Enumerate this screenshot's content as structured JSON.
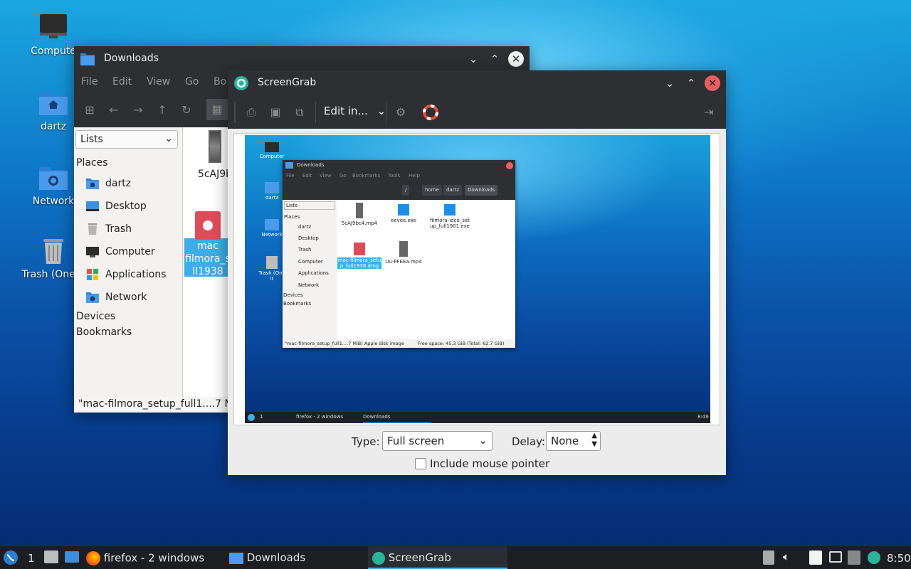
{
  "desktop": {
    "icons": [
      {
        "label": "Compute",
        "icon": "computer-icon"
      },
      {
        "label": "dartz",
        "icon": "home-folder-icon"
      },
      {
        "label": "Network",
        "icon": "network-folder-icon"
      },
      {
        "label": "Trash (One it",
        "icon": "trash-icon"
      }
    ]
  },
  "file_manager": {
    "title": "Downloads",
    "menu": [
      "File",
      "Edit",
      "View",
      "Go",
      "Bo"
    ],
    "view_mode": "Lists",
    "places_header": "Places",
    "places": [
      {
        "label": "dartz",
        "icon": "home-folder-icon"
      },
      {
        "label": "Desktop",
        "icon": "desktop-icon"
      },
      {
        "label": "Trash",
        "icon": "trash-icon"
      },
      {
        "label": "Computer",
        "icon": "computer-icon"
      },
      {
        "label": "Applications",
        "icon": "applications-icon"
      },
      {
        "label": "Network",
        "icon": "network-folder-icon"
      }
    ],
    "devices_header": "Devices",
    "bookmarks_header": "Bookmarks",
    "files": [
      {
        "label": "5cAJ9b",
        "icon": "video-file-icon"
      },
      {
        "label_lines": [
          "mac",
          "filmora_s",
          "ll1938"
        ],
        "icon": "dmg-file-icon",
        "selected": true
      }
    ],
    "status": "\"mac-filmora_setup_full1....7 M"
  },
  "screengrab": {
    "title": "ScreenGrab",
    "edit_label": "Edit in...",
    "type_label": "Type:",
    "type_value": "Full screen",
    "delay_label": "Delay:",
    "delay_value": "None",
    "include_pointer_label": "Include mouse pointer",
    "include_pointer_checked": false,
    "preview": {
      "desktop_icons": [
        "Computer",
        "dartz",
        "Network",
        "Trash (One it"
      ],
      "window_title": "Downloads",
      "menu": [
        "File",
        "Edit",
        "View",
        "Go",
        "Bookmarks",
        "Tools",
        "Help"
      ],
      "breadcrumbs": [
        "/",
        "home",
        "dartz",
        "Downloads"
      ],
      "view_mode": "Lists",
      "places_header": "Places",
      "places": [
        "dartz",
        "Desktop",
        "Trash",
        "Computer",
        "Applications",
        "Network"
      ],
      "devices_header": "Devices",
      "bookmarks_header": "Bookmarks",
      "files": [
        {
          "label": "5cAJ9bc4.mp4"
        },
        {
          "label": "eevee.exe"
        },
        {
          "label": "filmora-idco_setup_full1901.exe"
        },
        {
          "label": "mac-filmora_setup_full1938.dmg",
          "selected": true
        },
        {
          "label": "Uu-PFEEa.mp4"
        }
      ],
      "status_left": "\"mac-filmora_setup_full1....7 MiB) Apple disk image",
      "status_right": "Free space: 45.3 GiB (Total: 62.7 GiB)",
      "taskbar": {
        "workspace": "1",
        "firefox": "firefox - 2 windows",
        "downloads": "Downloads",
        "clock": "8:49"
      }
    }
  },
  "taskbar": {
    "workspace": "1",
    "tasks": [
      {
        "label": "firefox - 2 windows",
        "icon": "firefox-icon"
      },
      {
        "label": "Downloads",
        "icon": "folder-icon"
      },
      {
        "label": "ScreenGrab",
        "icon": "screengrab-icon",
        "active": true
      }
    ],
    "clock": "8:50"
  },
  "colors": {
    "accent": "#3daee9",
    "close_red": "#e95f5f",
    "selection": "#3daee9",
    "titlebar": "#2d2f33"
  }
}
